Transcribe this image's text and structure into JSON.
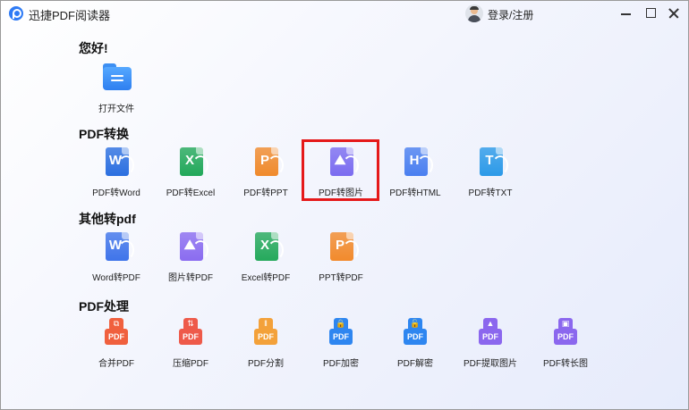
{
  "window": {
    "title": "迅捷PDF阅读器",
    "login_label": "登录/注册"
  },
  "sections": {
    "hello": {
      "title": "您好!"
    },
    "pdf_convert": {
      "title": "PDF转换"
    },
    "other_to_pdf": {
      "title": "其他转pdf"
    },
    "pdf_process": {
      "title": "PDF处理"
    }
  },
  "tools": {
    "open_file": {
      "label": "打开文件"
    },
    "pdf_to_word": {
      "label": "PDF转Word",
      "letter": "W",
      "color": "#2b6fe0"
    },
    "pdf_to_excel": {
      "label": "PDF转Excel",
      "letter": "X",
      "color": "#22a85a"
    },
    "pdf_to_ppt": {
      "label": "PDF转PPT",
      "letter": "P",
      "color": "#f08a2c"
    },
    "pdf_to_image": {
      "label": "PDF转图片",
      "letter": "⛰",
      "color": "#7b6cf0"
    },
    "pdf_to_html": {
      "label": "PDF转HTML",
      "letter": "H",
      "color": "#4a7ff0"
    },
    "pdf_to_txt": {
      "label": "PDF转TXT",
      "letter": "T",
      "color": "#2c9ae8"
    },
    "word_to_pdf": {
      "label": "Word转PDF",
      "letter": "W",
      "color": "#3f74ea"
    },
    "image_to_pdf": {
      "label": "图片转PDF",
      "letter": "⛰",
      "color": "#8a6cf0"
    },
    "excel_to_pdf": {
      "label": "Excel转PDF",
      "letter": "X",
      "color": "#25a95c"
    },
    "ppt_to_pdf": {
      "label": "PPT转PDF",
      "letter": "P",
      "color": "#f28a2c"
    },
    "merge_pdf": {
      "label": "合并PDF",
      "cap": "⧉",
      "color": "#f0603e"
    },
    "compress_pdf": {
      "label": "压缩PDF",
      "cap": "⇅",
      "color": "#ee5a4a"
    },
    "split_pdf": {
      "label": "PDF分割",
      "cap": "‖",
      "color": "#f3a13a"
    },
    "encrypt_pdf": {
      "label": "PDF加密",
      "cap": "🔒",
      "color": "#2e86f0"
    },
    "decrypt_pdf": {
      "label": "PDF解密",
      "cap": "🔓",
      "color": "#2e86f0"
    },
    "extract_images": {
      "label": "PDF提取图片",
      "cap": "▲",
      "color": "#8b67ee"
    },
    "long_image": {
      "label": "PDF转长图",
      "cap": "▣",
      "color": "#8b67ee"
    }
  }
}
